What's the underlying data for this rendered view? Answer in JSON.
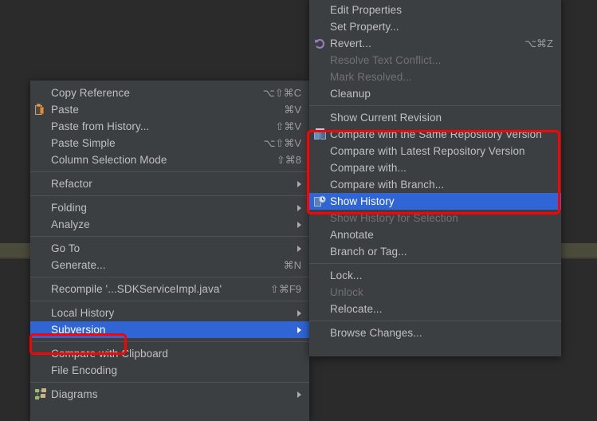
{
  "app": {
    "theme_background": "#2b2b2b",
    "menu_background": "#3c3f41",
    "selection_color": "#2f65d4",
    "highlight_color": "#ff0000",
    "text_color": "#bec0c2",
    "disabled_text_color": "#6f7174"
  },
  "editor_context_menu": {
    "name": "Editor context menu",
    "groups": [
      {
        "items": [
          {
            "label": "Copy Reference",
            "accel": "⌥⇧⌘C",
            "icon": "",
            "state": "normal",
            "submenu": false
          },
          {
            "label": "Paste",
            "accel": "⌘V",
            "icon": "paste-icon",
            "state": "normal",
            "submenu": false
          },
          {
            "label": "Paste from History...",
            "accel": "⇧⌘V",
            "icon": "",
            "state": "normal",
            "submenu": false
          },
          {
            "label": "Paste Simple",
            "accel": "⌥⇧⌘V",
            "icon": "",
            "state": "normal",
            "submenu": false
          },
          {
            "label": "Column Selection Mode",
            "accel": "⇧⌘8",
            "icon": "",
            "state": "normal",
            "submenu": false
          }
        ]
      },
      {
        "items": [
          {
            "label": "Refactor",
            "accel": "",
            "icon": "",
            "state": "normal",
            "submenu": true
          }
        ]
      },
      {
        "items": [
          {
            "label": "Folding",
            "accel": "",
            "icon": "",
            "state": "normal",
            "submenu": true
          },
          {
            "label": "Analyze",
            "accel": "",
            "icon": "",
            "state": "normal",
            "submenu": true
          }
        ]
      },
      {
        "items": [
          {
            "label": "Go To",
            "accel": "",
            "icon": "",
            "state": "normal",
            "submenu": true
          },
          {
            "label": "Generate...",
            "accel": "⌘N",
            "icon": "",
            "state": "normal",
            "submenu": false
          }
        ]
      },
      {
        "items": [
          {
            "label": "Recompile '...SDKServiceImpl.java'",
            "accel": "⇧⌘F9",
            "icon": "",
            "state": "normal",
            "submenu": false
          }
        ]
      },
      {
        "items": [
          {
            "label": "Local History",
            "accel": "",
            "icon": "",
            "state": "normal",
            "submenu": true
          },
          {
            "label": "Subversion",
            "accel": "",
            "icon": "",
            "state": "selected",
            "submenu": true,
            "highlighted": true
          }
        ]
      },
      {
        "items": [
          {
            "label": "Compare with Clipboard",
            "accel": "",
            "icon": "",
            "state": "normal",
            "submenu": false
          },
          {
            "label": "File Encoding",
            "accel": "",
            "icon": "",
            "state": "normal",
            "submenu": false
          }
        ]
      },
      {
        "items": [
          {
            "label": "Diagrams",
            "accel": "",
            "icon": "diagrams-icon",
            "state": "normal",
            "submenu": true
          }
        ]
      }
    ]
  },
  "subversion_submenu": {
    "name": "Subversion submenu",
    "groups": [
      {
        "items": [
          {
            "label": "Edit Properties",
            "accel": "",
            "icon": "",
            "state": "normal",
            "submenu": false
          },
          {
            "label": "Set Property...",
            "accel": "",
            "icon": "",
            "state": "normal",
            "submenu": false
          },
          {
            "label": "Revert...",
            "accel": "⌥⌘Z",
            "icon": "revert-icon",
            "state": "normal",
            "submenu": false
          },
          {
            "label": "Resolve Text Conflict...",
            "accel": "",
            "icon": "",
            "state": "disabled",
            "submenu": false
          },
          {
            "label": "Mark Resolved...",
            "accel": "",
            "icon": "",
            "state": "disabled",
            "submenu": false
          },
          {
            "label": "Cleanup",
            "accel": "",
            "icon": "",
            "state": "normal",
            "submenu": false
          }
        ]
      },
      {
        "items": [
          {
            "label": "Show Current Revision",
            "accel": "",
            "icon": "",
            "state": "normal",
            "submenu": false
          },
          {
            "label": "Compare with the Same Repository Version",
            "accel": "",
            "icon": "compare-icon",
            "state": "normal",
            "submenu": false
          },
          {
            "label": "Compare with Latest Repository Version",
            "accel": "",
            "icon": "",
            "state": "normal",
            "submenu": false
          },
          {
            "label": "Compare with...",
            "accel": "",
            "icon": "",
            "state": "normal",
            "submenu": false
          },
          {
            "label": "Compare with Branch...",
            "accel": "",
            "icon": "",
            "state": "normal",
            "submenu": false
          },
          {
            "label": "Show History",
            "accel": "",
            "icon": "history-icon",
            "state": "selected",
            "submenu": false
          },
          {
            "label": "Show History for Selection",
            "accel": "",
            "icon": "",
            "state": "disabled",
            "submenu": false
          },
          {
            "label": "Annotate",
            "accel": "",
            "icon": "",
            "state": "normal",
            "submenu": false
          },
          {
            "label": "Branch or Tag...",
            "accel": "",
            "icon": "",
            "state": "normal",
            "submenu": false
          }
        ]
      },
      {
        "items": [
          {
            "label": "Lock...",
            "accel": "",
            "icon": "",
            "state": "normal",
            "submenu": false
          },
          {
            "label": "Unlock",
            "accel": "",
            "icon": "",
            "state": "disabled",
            "submenu": false
          },
          {
            "label": "Relocate...",
            "accel": "",
            "icon": "",
            "state": "normal",
            "submenu": false
          }
        ]
      },
      {
        "items": [
          {
            "label": "Browse Changes...",
            "accel": "",
            "icon": "",
            "state": "normal",
            "submenu": false
          }
        ]
      }
    ]
  },
  "annotations": {
    "compare_group_box": "red-highlight-rectangle-compare-group",
    "subversion_box": "red-highlight-rectangle-subversion"
  }
}
